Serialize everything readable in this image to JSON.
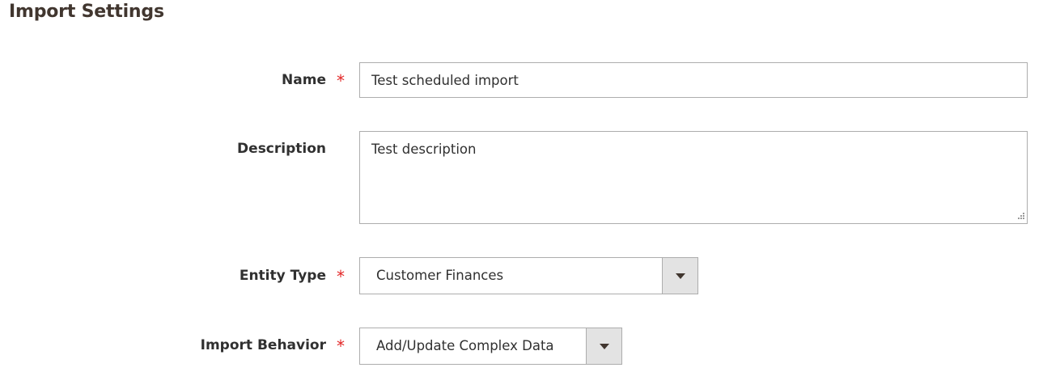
{
  "section": {
    "title": "Import Settings"
  },
  "fields": {
    "name": {
      "label": "Name",
      "required_mark": "*",
      "value": "Test scheduled import"
    },
    "description": {
      "label": "Description",
      "value": "Test description"
    },
    "entity_type": {
      "label": "Entity Type",
      "required_mark": "*",
      "selected": "Customer Finances"
    },
    "import_behavior": {
      "label": "Import Behavior",
      "required_mark": "*",
      "selected": "Add/Update Complex Data"
    }
  },
  "colors": {
    "required": "#e22626",
    "border": "#adadad",
    "title": "#41362f",
    "select_toggle_bg": "#e3e3e3"
  }
}
